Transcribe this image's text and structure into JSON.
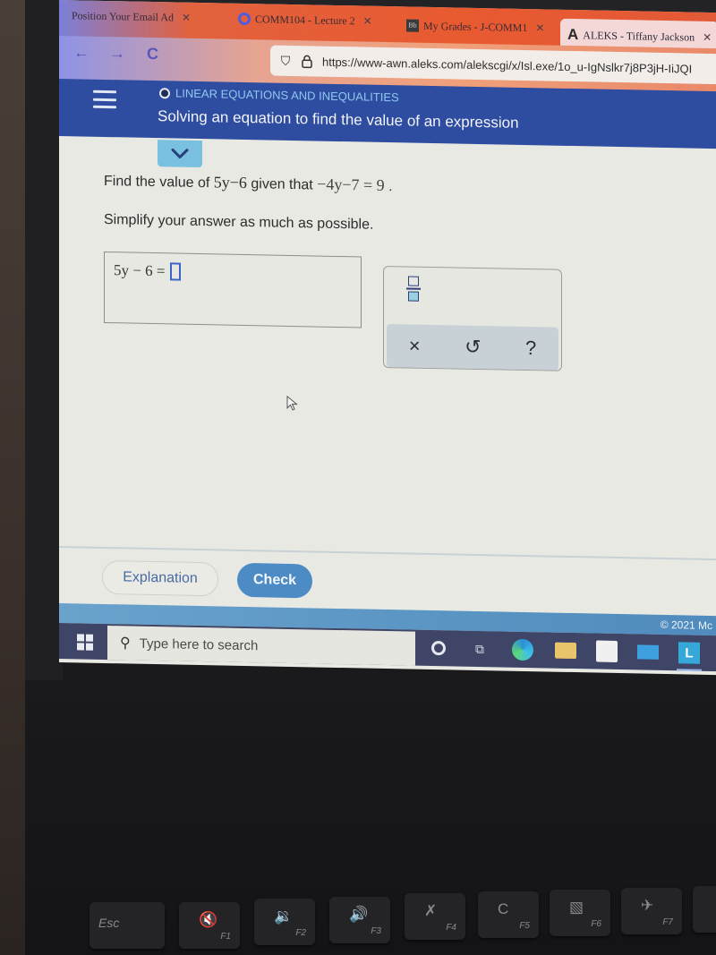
{
  "browser": {
    "tabs": [
      {
        "label": "Position Your Email Ad",
        "close": "✕",
        "icon": "email-ad-icon"
      },
      {
        "label": "COMM104 - Lecture 2",
        "close": "✕",
        "icon": "ring-icon"
      },
      {
        "label": "My Grades - J-COMM1",
        "close": "✕",
        "icon": "bb-icon",
        "icon_text": "Bb"
      },
      {
        "label": "ALEKS - Tiffany Jackson",
        "close": "✕",
        "icon": "aleks-a-icon",
        "icon_text": "A",
        "active": true
      }
    ],
    "nav": {
      "back": "←",
      "forward": "→",
      "reload": "C"
    },
    "url": "https://www-awn.aleks.com/alekscgi/x/Isl.exe/1o_u-IgNslkr7j8P3jH-IiJQI",
    "shield_icon": "⛉",
    "lock_icon": "🔒"
  },
  "aleks": {
    "topic": "LINEAR EQUATIONS AND INEQUALITIES",
    "title": "Solving an equation to find the value of an expression",
    "question": {
      "prefix": "Find the value of",
      "expression": "5y−6",
      "middle": "given that",
      "equation": "−4y−7 = 9",
      "suffix": ".",
      "instruction": "Simplify your answer as much as possible."
    },
    "answer": {
      "lhs": "5y − 6 =",
      "value": ""
    },
    "toolpad": {
      "clear": "×",
      "undo": "↺",
      "help": "?"
    },
    "buttons": {
      "explanation": "Explanation",
      "check": "Check"
    },
    "copyright": "© 2021 Mc"
  },
  "taskbar": {
    "search_placeholder": "Type here to search",
    "search_icon": "⚲",
    "task_view_icon": "⧉",
    "aleks_app_letter": "L"
  },
  "keyboard": {
    "keys": [
      {
        "label": "Esc",
        "fn": ""
      },
      {
        "glyph": "🔇",
        "fn": "F1"
      },
      {
        "glyph": "🔉",
        "fn": "F2"
      },
      {
        "glyph": "🔊",
        "fn": "F3"
      },
      {
        "glyph": "✗",
        "fn": "F4"
      },
      {
        "glyph": "C",
        "fn": "F5"
      },
      {
        "glyph": "▧",
        "fn": "F6"
      },
      {
        "glyph": "✈",
        "fn": "F7"
      }
    ]
  }
}
